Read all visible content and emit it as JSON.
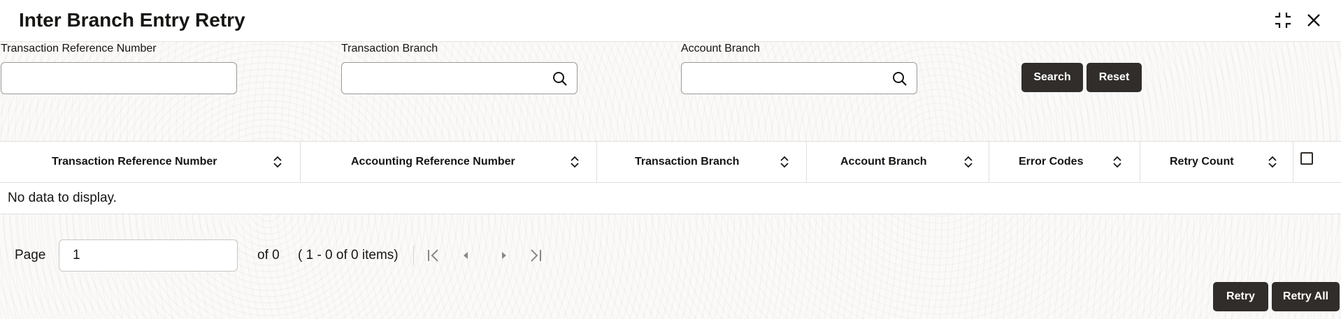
{
  "header": {
    "title": "Inter Branch Entry Retry",
    "icons": [
      "collapse-icon",
      "close-icon"
    ]
  },
  "filters": {
    "txn_ref_label": "Transaction Reference Number",
    "txn_ref_value": "",
    "txn_branch_label": "Transaction Branch",
    "txn_branch_value": "",
    "acct_branch_label": "Account Branch",
    "acct_branch_value": "",
    "search_label": "Search",
    "reset_label": "Reset"
  },
  "grid": {
    "columns": [
      "Transaction Reference Number",
      "Accounting Reference Number",
      "Transaction Branch",
      "Account Branch",
      "Error Codes",
      "Retry Count"
    ],
    "empty_message": "No data to display."
  },
  "pager": {
    "page_label": "Page",
    "page_value": "1",
    "of_text": "of 0",
    "items_text": "( 1 - 0 of 0 items)"
  },
  "actions": {
    "retry_label": "Retry",
    "retry_all_label": "Retry All"
  },
  "colors": {
    "button_bg": "#312d2a",
    "button_text": "#ffffff"
  }
}
